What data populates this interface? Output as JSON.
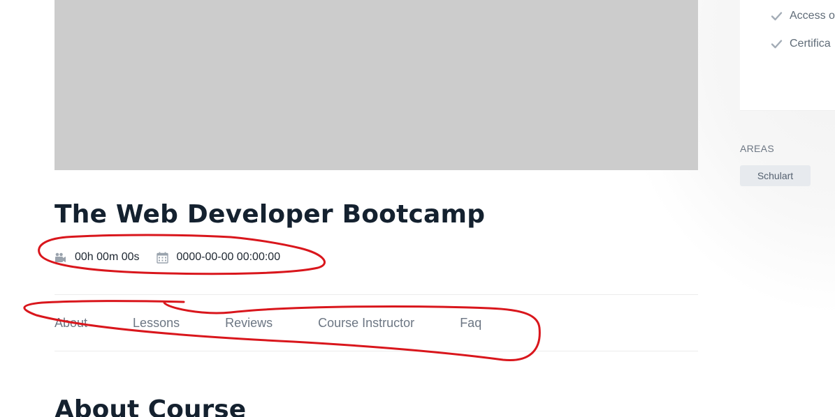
{
  "course": {
    "title": "The Web Developer Bootcamp",
    "duration": "00h 00m 00s",
    "date": "0000-00-00 00:00:00"
  },
  "tabs": [
    {
      "label": "About"
    },
    {
      "label": "Lessons"
    },
    {
      "label": "Reviews"
    },
    {
      "label": "Course Instructor"
    },
    {
      "label": "Faq"
    }
  ],
  "section": {
    "heading": "About Course"
  },
  "sidebar": {
    "features": [
      {
        "label": "Access o",
        "icon": "check-icon"
      },
      {
        "label": "Certifica",
        "icon": "check-icon"
      }
    ],
    "areas_label": "AREAS",
    "areas": [
      {
        "label": "Schulart"
      }
    ]
  },
  "colors": {
    "title": "#14212f",
    "tab_text": "#6c7683",
    "image_placeholder": "#cccccc",
    "annotation": "#d9161c",
    "badge_bg": "#e7eaee"
  },
  "icons": {
    "duration": "video-camera-icon",
    "date": "calendar-icon"
  }
}
